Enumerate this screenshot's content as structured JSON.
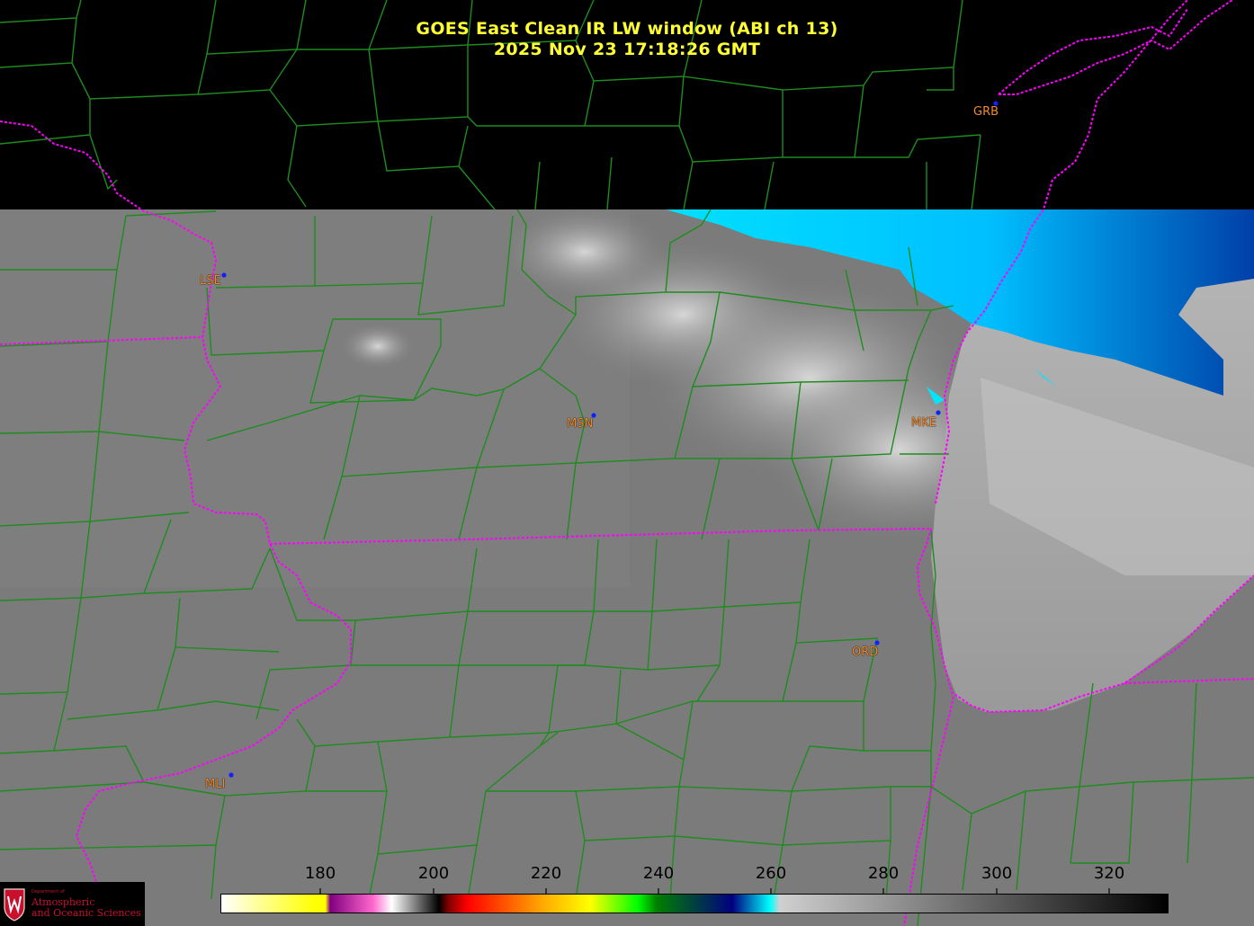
{
  "title": {
    "line1": "GOES East Clean IR LW window (ABI ch 13)",
    "line2": "2025 Nov 23  17:18:26 GMT"
  },
  "cities": [
    {
      "code": "GRB"
    },
    {
      "code": "LSE"
    },
    {
      "code": "MSN"
    },
    {
      "code": "MKE"
    },
    {
      "code": "ORD"
    },
    {
      "code": "MLI"
    }
  ],
  "colorbar": {
    "ticks": [
      "180",
      "200",
      "220",
      "240",
      "260",
      "280",
      "300",
      "320"
    ],
    "stops": [
      "#ffffff",
      "#ffff00",
      "#ffff00",
      "#800080",
      "#ff66cc",
      "#ffffff",
      "#000000",
      "#800000",
      "#ff0000",
      "#ffaa00",
      "#ffff00",
      "#00ff00",
      "#008000",
      "#000080",
      "#00ffff",
      "#d0d0d0",
      "#000000"
    ]
  },
  "logo": {
    "department": "Department of",
    "line1": "Atmospheric",
    "line2": "and Oceanic Sciences"
  },
  "colors": {
    "title": "#ffff33",
    "county_lines": "#1e8c1e",
    "state_lines": "#ff00ff",
    "city_label": "#f08a2a",
    "ground": "#7c7c7c"
  }
}
